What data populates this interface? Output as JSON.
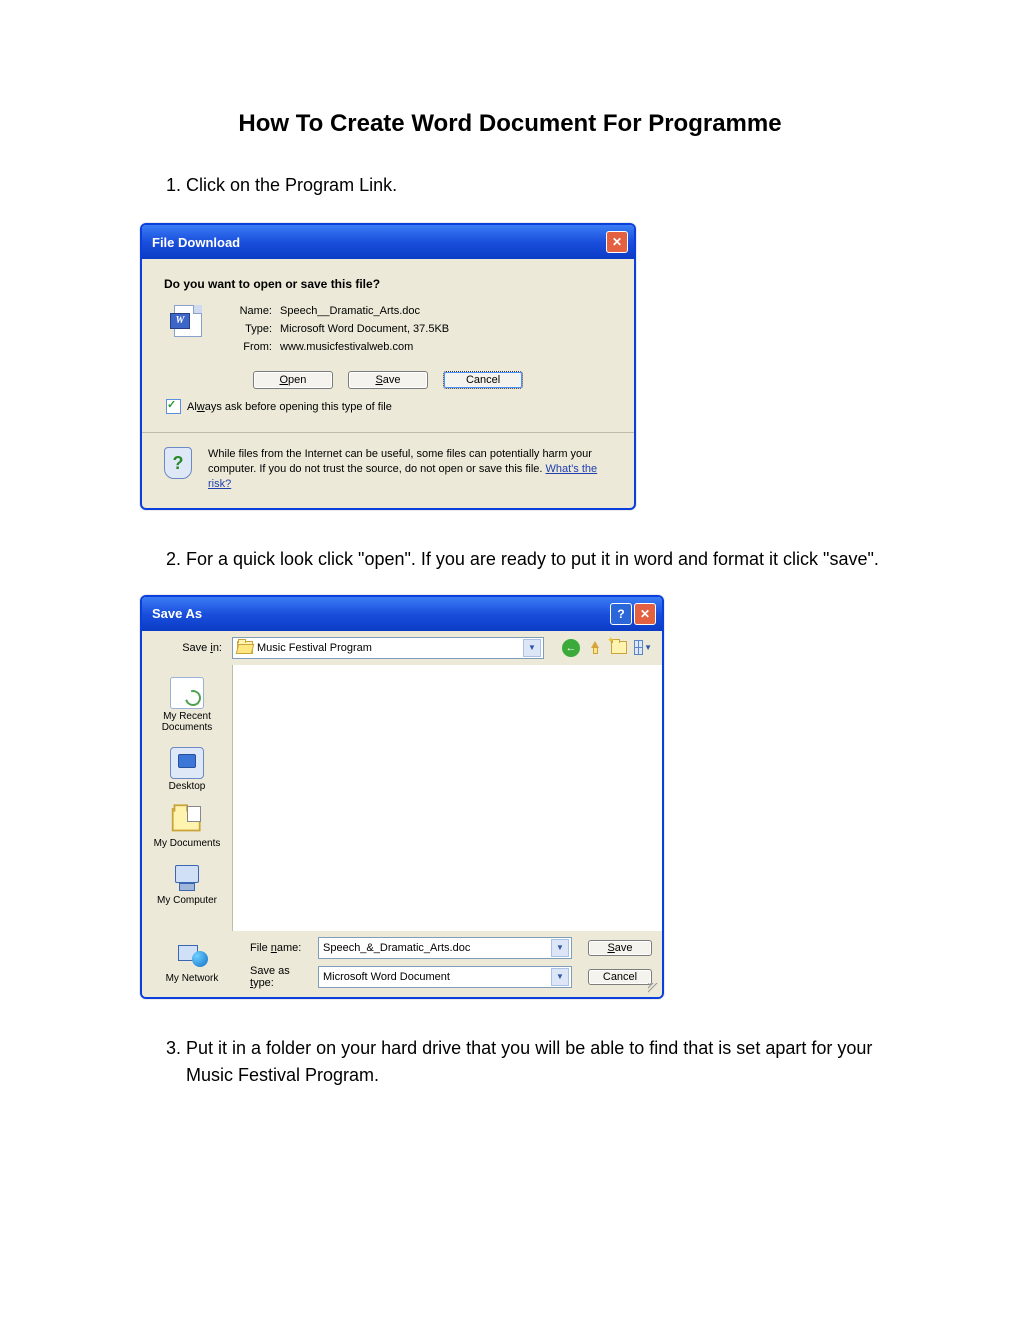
{
  "doc": {
    "title": "How To Create Word Document For Programme",
    "steps": [
      "Click on the Program Link.",
      "For a quick look click \"open\". If you are ready to put it in word and format it click \"save\".",
      "Put it in a folder on your hard drive that you will be able to find that is set apart for your Music Festival Program."
    ]
  },
  "download": {
    "title": "File Download",
    "prompt": "Do you want to open or save this file?",
    "name_label": "Name:",
    "type_label": "Type:",
    "from_label": "From:",
    "name": "Speech__Dramatic_Arts.doc",
    "type": "Microsoft Word Document, 37.5KB",
    "from": "www.musicfestivalweb.com",
    "open": "Open",
    "save": "Save",
    "cancel": "Cancel",
    "always_check": "Always ask before opening this type of file",
    "warn": "While files from the Internet can be useful, some files can potentially harm your computer. If you do not trust the source, do not open or save this file. ",
    "risk_link": "What's the risk?"
  },
  "saveas": {
    "title": "Save As",
    "savein_label": "Save in:",
    "savein_value": "Music Festival Program",
    "places": {
      "recent": "My Recent Documents",
      "desktop": "Desktop",
      "mydocs": "My Documents",
      "mycomp": "My Computer",
      "mynet": "My Network"
    },
    "filename_label": "File name:",
    "filename_value": "Speech_&_Dramatic_Arts.doc",
    "saveastype_label": "Save as type:",
    "saveastype_value": "Microsoft Word Document",
    "save": "Save",
    "cancel": "Cancel"
  }
}
